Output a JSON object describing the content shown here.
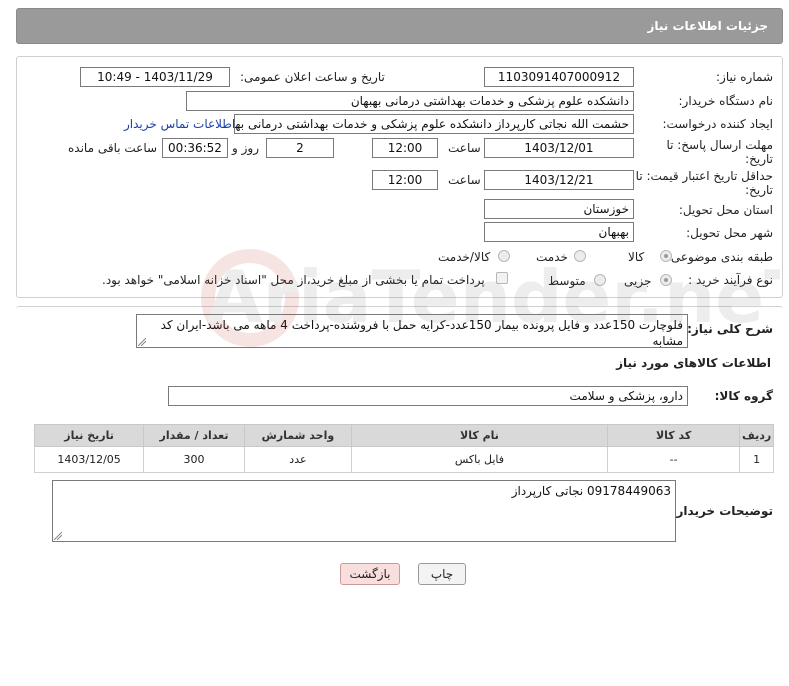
{
  "header": {
    "title": "جزئیات اطلاعات نیاز"
  },
  "form": {
    "need_number": {
      "label": "شماره نیاز:",
      "value": "1103091407000912"
    },
    "announce_datetime": {
      "label": "تاریخ و ساعت اعلان عمومی:",
      "value": "1403/11/29 - 10:49"
    },
    "buyer_org": {
      "label": "نام دستگاه خریدار:",
      "value": "دانشکده علوم پزشکی و خدمات بهداشتی  درمانی بهبهان"
    },
    "requester": {
      "label": "ایجاد کننده درخواست:",
      "value": "حشمت الله نجاتی کارپرداز دانشکده علوم پزشکی و خدمات بهداشتی  درمانی بهبهان",
      "contact_link": "اطلاعات تماس خریدار"
    },
    "send_deadline": {
      "label_line1": "مهلت ارسال پاسخ: تا",
      "label_line2": "تاریخ:",
      "date": "1403/12/01",
      "time_label": "ساعت",
      "time": "12:00",
      "days": "2",
      "days_label": "روز و",
      "remaining": "00:36:52",
      "remaining_label": "ساعت باقی مانده"
    },
    "price_validity": {
      "label_line1": "حداقل تاریخ اعتبار قیمت: تا",
      "label_line2": "تاریخ:",
      "date": "1403/12/21",
      "time_label": "ساعت",
      "time": "12:00"
    },
    "province": {
      "label": "استان محل تحویل:",
      "value": "خوزستان"
    },
    "city": {
      "label": "شهر محل تحویل:",
      "value": "بهبهان"
    },
    "category": {
      "label": "طبقه بندی موضوعی:",
      "options": [
        "کالا",
        "خدمت",
        "کالا/خدمت"
      ],
      "selected": "کالا"
    },
    "process_type": {
      "label": "نوع فرآیند خرید :",
      "options": [
        "جزیی",
        "متوسط"
      ],
      "selected": "جزیی",
      "checkbox_label": "پرداخت تمام یا بخشی از مبلغ خرید،از محل \"اسناد خزانه اسلامی\" خواهد بود."
    }
  },
  "description": {
    "label": "شرح کلی نیاز:",
    "value": "فلوچارت 150عدد و فایل پرونده بیمار 150عدد-کرایه حمل با فروشنده-پرداخت 4 ماهه می باشد-ایران کد مشابه"
  },
  "goods_section": {
    "title": "اطلاعات کالاهای مورد نیاز",
    "group_label": "گروه کالا:",
    "group_value": "دارو، پزشکی و سلامت"
  },
  "table": {
    "headers": [
      "ردیف",
      "کد کالا",
      "نام کالا",
      "واحد شمارش",
      "تعداد / مقدار",
      "تاریخ نیاز"
    ],
    "rows": [
      [
        "1",
        "--",
        "فایل باکس",
        "عدد",
        "300",
        "1403/12/05"
      ]
    ]
  },
  "buyer_notes": {
    "label": "توضیحات خریدار:",
    "value": "09178449063 نجاتی کارپرداز"
  },
  "buttons": {
    "print": "چاپ",
    "back": "بازگشت"
  },
  "watermark": {
    "text": "AriaTender.neT"
  }
}
